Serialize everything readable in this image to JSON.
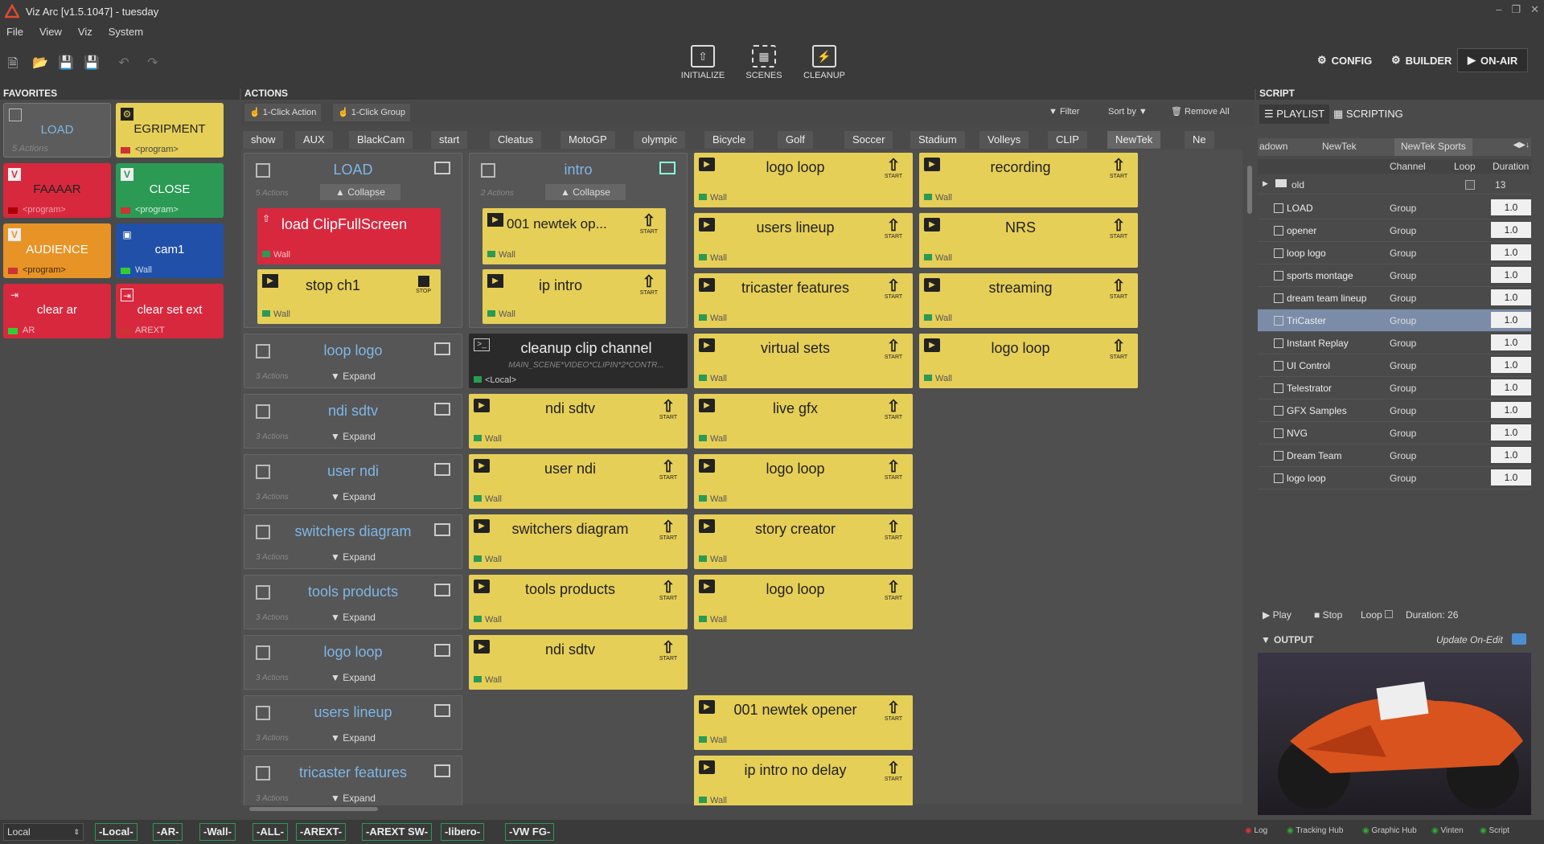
{
  "app": {
    "title": "Viz Arc [v1.5.1047] - tuesday"
  },
  "menu": [
    "File",
    "View",
    "Viz",
    "System"
  ],
  "toolbar": {
    "initialize": "INITIALIZE",
    "scenes": "SCENES",
    "cleanup": "CLEANUP",
    "config": "CONFIG",
    "builder": "BUILDER",
    "onair": "ON-AIR"
  },
  "sections": {
    "favorites": "FAVORITES",
    "actions": "ACTIONS",
    "script": "SCRIPT",
    "output": "OUTPUT"
  },
  "favorites": [
    {
      "label": "LOAD",
      "sub": "5 Actions",
      "color": "grey"
    },
    {
      "label": "EGRIPMENT",
      "sub": "<program>",
      "color": "yellow"
    },
    {
      "label": "FAAAAR",
      "sub": "<program>",
      "color": "red"
    },
    {
      "label": "CLOSE",
      "sub": "<program>",
      "color": "green"
    },
    {
      "label": "AUDIENCE",
      "sub": "<program>",
      "color": "orange"
    },
    {
      "label": "cam1",
      "sub": "Wall",
      "color": "blue"
    },
    {
      "label": "clear ar",
      "sub": "AR",
      "color": "red"
    },
    {
      "label": "clear set ext",
      "sub": "AREXT",
      "color": "red"
    }
  ],
  "actions_toolbar": {
    "one_click_action": "1-Click Action",
    "one_click_group": "1-Click Group",
    "filter": "Filter",
    "sort_by": "Sort by",
    "remove_all": "Remove All"
  },
  "tabs": [
    "show",
    "AUX",
    "BlackCam",
    "start",
    "Cleatus",
    "MotoGP",
    "olympic",
    "Bicycle",
    "Golf",
    "Soccer",
    "Stadium",
    "Volleys",
    "CLIP",
    "NewTek",
    "Ne"
  ],
  "load_group": {
    "name": "LOAD",
    "count": "5 Actions",
    "collapse": "Collapse",
    "items": [
      "load ClipFullScreen",
      "stop ch1"
    ],
    "wall": "Wall",
    "stop": "STOP"
  },
  "intro_group": {
    "name": "intro",
    "count": "2 Actions",
    "collapse": "Collapse",
    "items": [
      "001 newtek op...",
      "ip intro"
    ]
  },
  "cleanup": {
    "name": "cleanup clip channel",
    "path": "MAIN_SCENE*VIDEO*CLIPIN*2*CONTR...",
    "local": "<Local>"
  },
  "groups": [
    {
      "name": "loop logo",
      "count": "3 Actions",
      "expand": "Expand"
    },
    {
      "name": "ndi sdtv",
      "count": "3 Actions",
      "expand": "Expand"
    },
    {
      "name": "user ndi",
      "count": "3 Actions",
      "expand": "Expand"
    },
    {
      "name": "switchers diagram",
      "count": "3 Actions",
      "expand": "Expand"
    },
    {
      "name": "tools products",
      "count": "3 Actions",
      "expand": "Expand"
    },
    {
      "name": "logo loop",
      "count": "3 Actions",
      "expand": "Expand"
    },
    {
      "name": "users lineup",
      "count": "3 Actions",
      "expand": "Expand"
    },
    {
      "name": "tricaster features",
      "count": "3 Actions",
      "expand": "Expand"
    }
  ],
  "col2": [
    "ndi sdtv",
    "user ndi",
    "switchers diagram",
    "tools products",
    "ndi sdtv"
  ],
  "col3": [
    "logo loop",
    "users lineup",
    "tricaster features",
    "virtual sets",
    "live gfx",
    "logo loop",
    "story creator",
    "logo loop",
    "001 newtek opener",
    "ip intro no delay"
  ],
  "col4": [
    "recording",
    "NRS",
    "streaming",
    "logo loop"
  ],
  "tile_labels": {
    "wall": "Wall",
    "start": "START"
  },
  "script": {
    "tab_playlist": "PLAYLIST",
    "tab_scripting": "SCRIPTING",
    "subtabs": [
      "adown",
      "NewTek",
      "NewTek Sports"
    ],
    "headers": [
      "Channel",
      "Loop",
      "Duration"
    ],
    "folder": {
      "name": "old",
      "duration": "13"
    },
    "rows": [
      {
        "name": "LOAD",
        "channel": "Group",
        "duration": "1.0"
      },
      {
        "name": "opener",
        "channel": "Group",
        "duration": "1.0"
      },
      {
        "name": "loop logo",
        "channel": "Group",
        "duration": "1.0"
      },
      {
        "name": "sports montage",
        "channel": "Group",
        "duration": "1.0"
      },
      {
        "name": "dream team lineup",
        "channel": "Group",
        "duration": "1.0"
      },
      {
        "name": "TriCaster",
        "channel": "Group",
        "duration": "1.0"
      },
      {
        "name": "Instant Replay",
        "channel": "Group",
        "duration": "1.0"
      },
      {
        "name": "UI Control",
        "channel": "Group",
        "duration": "1.0"
      },
      {
        "name": "Telestrator",
        "channel": "Group",
        "duration": "1.0"
      },
      {
        "name": "GFX Samples",
        "channel": "Group",
        "duration": "1.0"
      },
      {
        "name": "NVG",
        "channel": "Group",
        "duration": "1.0"
      },
      {
        "name": "Dream Team",
        "channel": "Group",
        "duration": "1.0"
      },
      {
        "name": "logo loop",
        "channel": "Group",
        "duration": "1.0"
      }
    ],
    "selected_row": 5,
    "play": "Play",
    "stop": "Stop",
    "loop": "Loop",
    "duration": "Duration: 26",
    "update_on_edit": "Update On-Edit"
  },
  "statusbar": {
    "local_select": "Local",
    "pills": [
      "Local",
      "AR",
      "Wall",
      "ALL",
      "AREXT",
      "AREXT SW",
      "libero",
      "VW FG"
    ],
    "right": [
      "Log",
      "Tracking Hub",
      "Graphic Hub",
      "Vinten",
      "Script"
    ]
  },
  "colors": {
    "yellow": "#e6cf57",
    "red": "#d8283e",
    "green": "#2a9a55",
    "blue": "#2150a8",
    "orange": "#e89325",
    "link": "#7fb6e6",
    "selected": "#7a8ca8"
  }
}
